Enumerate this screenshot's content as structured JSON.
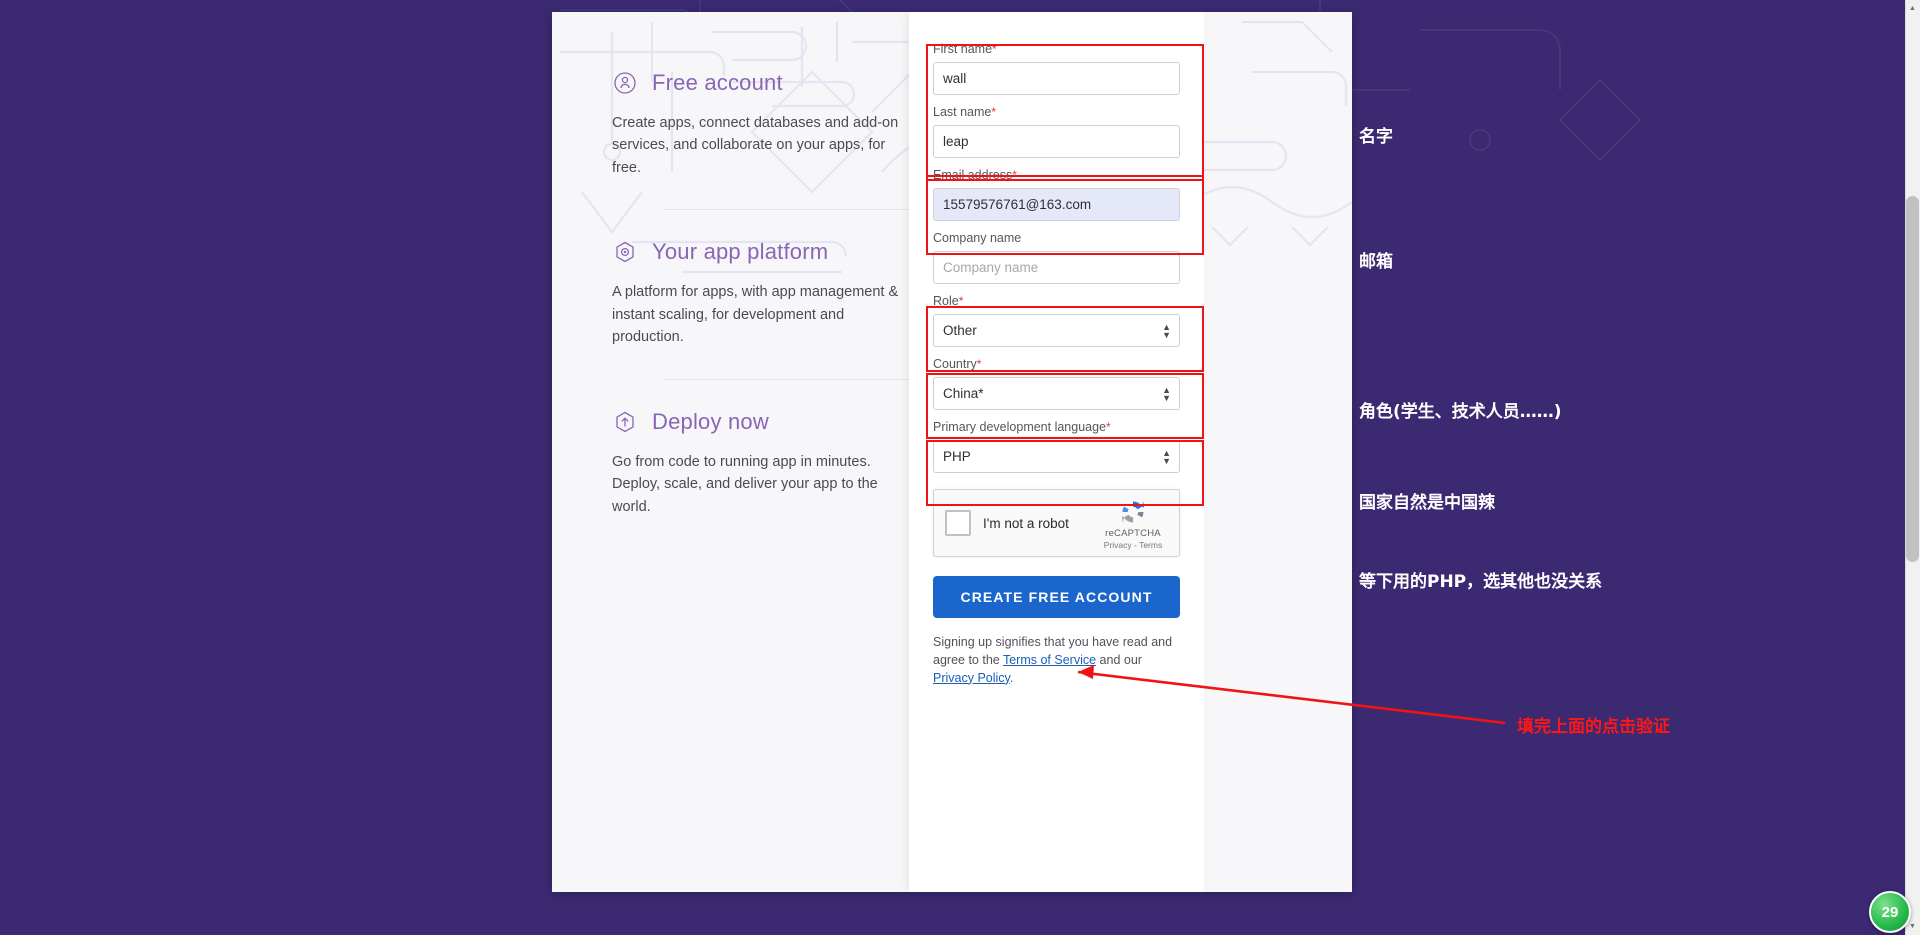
{
  "theme": {
    "page_background": "#3b2a72",
    "card_background": "#f7f7f9",
    "form_background": "#ffffff",
    "accent_purple": "#8a65b5",
    "annotation_red": "#ef1414",
    "button_blue": "#1a66cc",
    "email_field_fill": "#e4e8f8"
  },
  "left_panel": {
    "features": [
      {
        "icon": "user-circle-icon",
        "title": "Free account",
        "description": "Create apps, connect databases and add-on services, and collaborate on your apps, for free."
      },
      {
        "icon": "hexagon-target-icon",
        "title": "Your app platform",
        "description": "A platform for apps, with app management & instant scaling, for development and production."
      },
      {
        "icon": "hexagon-upload-icon",
        "title": "Deploy now",
        "description": "Go from code to running app in minutes. Deploy, scale, and deliver your app to the world."
      }
    ]
  },
  "form": {
    "fields": {
      "first_name": {
        "label": "First name",
        "required_mark": "*",
        "value": "wall",
        "placeholder": "First name"
      },
      "last_name": {
        "label": "Last name",
        "required_mark": "*",
        "value": "leap",
        "placeholder": "Last name"
      },
      "email": {
        "label": "Email address",
        "required_mark": "*",
        "value": "15579576761@163.com",
        "placeholder": "Email address"
      },
      "company": {
        "label": "Company name",
        "required_mark": "",
        "value": "",
        "placeholder": "Company name"
      },
      "role": {
        "label": "Role",
        "required_mark": "*",
        "value": "Other"
      },
      "country": {
        "label": "Country",
        "required_mark": "*",
        "value": "China*"
      },
      "language": {
        "label": "Primary development language",
        "required_mark": "*",
        "value": "PHP"
      }
    },
    "captcha": {
      "checkbox_label": "I'm not a robot",
      "brand": "reCAPTCHA",
      "legal": "Privacy - Terms"
    },
    "submit_label": "CREATE FREE ACCOUNT",
    "legal_prefix": "Signing up signifies that you have read and agree to the ",
    "legal_terms_link": "Terms of Service",
    "legal_middle": " and our ",
    "legal_privacy_link": "Privacy Policy",
    "legal_suffix": "."
  },
  "annotations": {
    "name": "名字",
    "email": "邮箱",
    "role": "角色(学生、技术人员……)",
    "country": "国家自然是中国辣",
    "language": "等下用的PHP，选其他也没关系",
    "captcha": "填完上面的点击验证"
  },
  "overlay": {
    "badge_count": "29"
  }
}
